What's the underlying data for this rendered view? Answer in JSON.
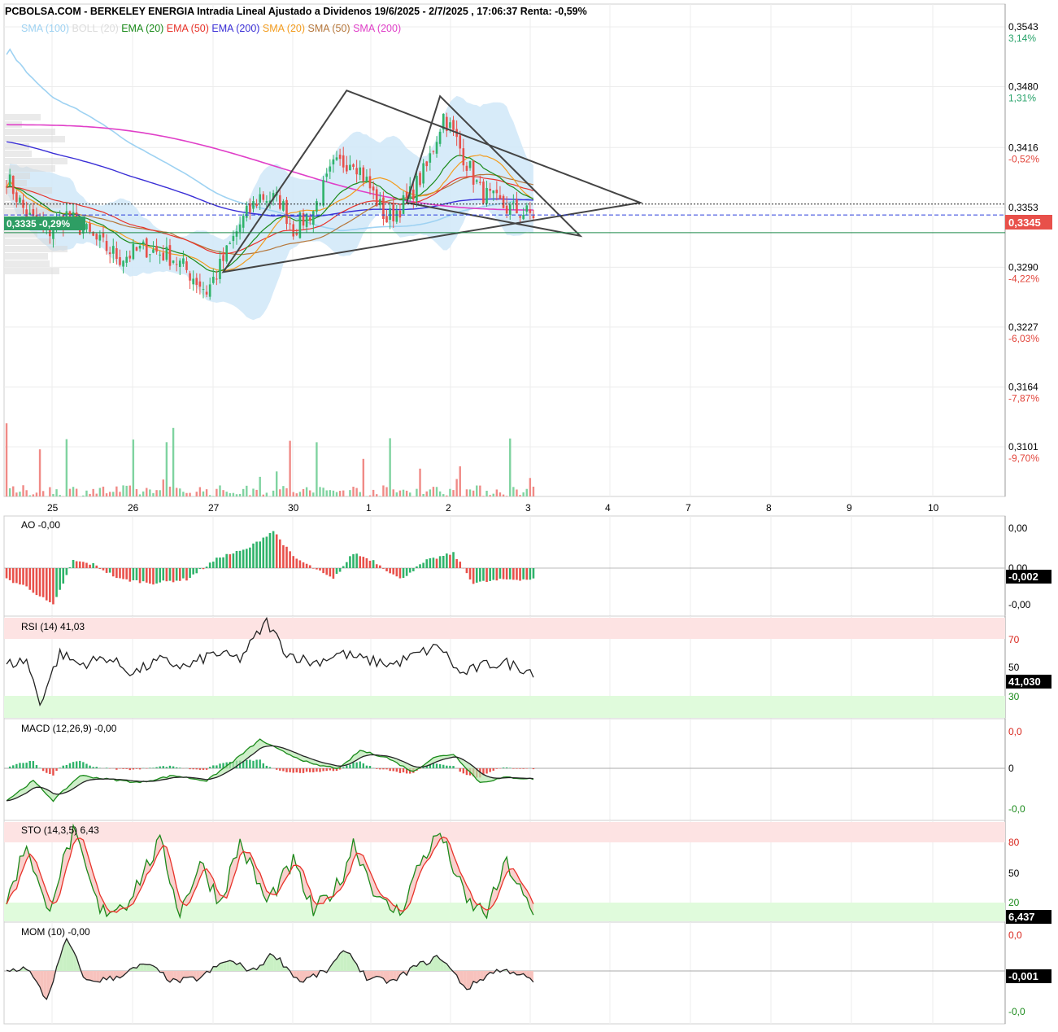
{
  "title": "PCBOLSA.COM - BERKELEY ENERGIA Intradia Lineal Ajustado a Dividenos 19/6/2025 - 2/7/2025 , 17:06:37 Renta: -0,59%",
  "legend": [
    {
      "label": "SMA (100)",
      "color": "#9ed2f2"
    },
    {
      "label": "BOLL (20)",
      "color": "#dcdcdc"
    },
    {
      "label": "EMA (20)",
      "color": "#1a8a1a"
    },
    {
      "label": "EMA (50)",
      "color": "#e8332a"
    },
    {
      "label": "EMA (200)",
      "color": "#3a2fd6"
    },
    {
      "label": "SMA (20)",
      "color": "#f39c1e"
    },
    {
      "label": "SMA (50)",
      "color": "#b5763a"
    },
    {
      "label": "SMA (200)",
      "color": "#e03fc8"
    }
  ],
  "price_axis": [
    {
      "value": "0,3543",
      "pct": "3,14%",
      "pct_color": "#26a269"
    },
    {
      "value": "0,3480",
      "pct": "1,31%",
      "pct_color": "#26a269"
    },
    {
      "value": "0,3416",
      "pct": "-0,52%",
      "pct_color": "#e2443a"
    },
    {
      "value": "0,3353",
      "pct": "",
      "pct_color": "#e2443a"
    },
    {
      "value": "0,3290",
      "pct": "-4,22%",
      "pct_color": "#e2443a"
    },
    {
      "value": "0,3227",
      "pct": "-6,03%",
      "pct_color": "#e2443a"
    },
    {
      "value": "0,3164",
      "pct": "-7,87%",
      "pct_color": "#e2443a"
    },
    {
      "value": "0,3101",
      "pct": "-9,70%",
      "pct_color": "#e2443a"
    }
  ],
  "last_price_tag": "0,3345",
  "current_price_label": "0,3335 -0,29%",
  "x_axis_labels": [
    "25",
    "26",
    "27",
    "30",
    "1",
    "2",
    "3",
    "4",
    "7",
    "8",
    "9",
    "10"
  ],
  "colors": {
    "up": "#2fb36a",
    "down": "#e8504a",
    "band": "#d3e9f8"
  },
  "chart_data": {
    "type": "candlestick",
    "title": "PCBOLSA.COM - BERKELEY ENERGIA Intradia Lineal Ajustado a Dividenos 19/6/2025 - 2/7/2025 , 17:06:37 Renta: -0,59%",
    "x": [
      "25",
      "26",
      "27",
      "30",
      "1",
      "2",
      "3",
      "4",
      "7",
      "8",
      "9",
      "10"
    ],
    "y_ticks": [
      0.3543,
      0.348,
      0.3416,
      0.3353,
      0.329,
      0.3227,
      0.3164,
      0.3101
    ],
    "ylim": [
      0.308,
      0.356
    ],
    "last_close": 0.3345,
    "reference_price": 0.3335,
    "reference_change": "-0,29%",
    "close_anchors": [
      [
        0,
        0.3385
      ],
      [
        6,
        0.3345
      ],
      [
        12,
        0.3325
      ],
      [
        18,
        0.3345
      ],
      [
        26,
        0.332
      ],
      [
        34,
        0.33
      ],
      [
        42,
        0.331
      ],
      [
        50,
        0.33
      ],
      [
        56,
        0.328
      ],
      [
        60,
        0.3265
      ],
      [
        64,
        0.329
      ],
      [
        70,
        0.3335
      ],
      [
        76,
        0.3365
      ],
      [
        82,
        0.336
      ],
      [
        86,
        0.333
      ],
      [
        92,
        0.335
      ],
      [
        98,
        0.3395
      ],
      [
        104,
        0.3405
      ],
      [
        108,
        0.338
      ],
      [
        114,
        0.334
      ],
      [
        120,
        0.336
      ],
      [
        126,
        0.3395
      ],
      [
        131,
        0.345
      ],
      [
        134,
        0.343
      ],
      [
        138,
        0.34
      ],
      [
        142,
        0.337
      ],
      [
        146,
        0.336
      ],
      [
        150,
        0.3352
      ],
      [
        154,
        0.3348
      ],
      [
        158,
        0.3345
      ]
    ],
    "triangles": [
      {
        "points": [
          [
            65,
            0.3285
          ],
          [
            102,
            0.3476
          ],
          [
            190,
            0.3358
          ]
        ]
      },
      {
        "points": [
          [
            120,
            0.3358
          ],
          [
            172,
            0.3323
          ],
          [
            130,
            0.347
          ]
        ]
      }
    ],
    "volume_ylim": [
      0,
      100
    ],
    "indicators": [
      {
        "name": "AO",
        "label": "AO",
        "value": "-0,00",
        "axis": [
          "0,00",
          "0,00",
          "-0,00"
        ],
        "last": "-0,002",
        "anchors": [
          [
            0,
            -0.3
          ],
          [
            6,
            -0.5
          ],
          [
            14,
            -1.0
          ],
          [
            20,
            0.2
          ],
          [
            26,
            0.1
          ],
          [
            34,
            -0.3
          ],
          [
            44,
            -0.4
          ],
          [
            54,
            -0.3
          ],
          [
            64,
            0.3
          ],
          [
            72,
            0.5
          ],
          [
            80,
            1.0
          ],
          [
            86,
            0.3
          ],
          [
            92,
            0.0
          ],
          [
            98,
            -0.3
          ],
          [
            104,
            0.4
          ],
          [
            110,
            0.2
          ],
          [
            118,
            -0.3
          ],
          [
            126,
            0.2
          ],
          [
            134,
            0.4
          ],
          [
            140,
            -0.4
          ],
          [
            150,
            -0.3
          ],
          [
            158,
            -0.3
          ]
        ]
      },
      {
        "name": "RSI",
        "label": "RSI (14)",
        "value": "41,03",
        "levels": [
          "70",
          "50",
          "30"
        ],
        "last": "41,030",
        "anchors": [
          [
            0,
            52
          ],
          [
            6,
            55
          ],
          [
            10,
            25
          ],
          [
            16,
            60
          ],
          [
            22,
            52
          ],
          [
            30,
            57
          ],
          [
            38,
            46
          ],
          [
            46,
            55
          ],
          [
            54,
            50
          ],
          [
            62,
            60
          ],
          [
            70,
            56
          ],
          [
            78,
            82
          ],
          [
            84,
            60
          ],
          [
            92,
            53
          ],
          [
            100,
            60
          ],
          [
            108,
            55
          ],
          [
            116,
            52
          ],
          [
            124,
            60
          ],
          [
            130,
            65
          ],
          [
            136,
            45
          ],
          [
            144,
            52
          ],
          [
            150,
            53
          ],
          [
            158,
            47
          ]
        ]
      },
      {
        "name": "MACD",
        "label": "MACD (12,26,9)",
        "value": "-0,00",
        "axis": [
          "0,0",
          "0",
          "-0,0"
        ],
        "anchors": [
          [
            0,
            -0.9
          ],
          [
            8,
            -0.35
          ],
          [
            14,
            -0.9
          ],
          [
            22,
            -0.2
          ],
          [
            30,
            -0.3
          ],
          [
            40,
            -0.4
          ],
          [
            50,
            -0.2
          ],
          [
            60,
            -0.35
          ],
          [
            68,
            0.2
          ],
          [
            76,
            0.8
          ],
          [
            82,
            0.5
          ],
          [
            92,
            0.1
          ],
          [
            100,
            0.0
          ],
          [
            106,
            0.5
          ],
          [
            114,
            0.3
          ],
          [
            122,
            -0.1
          ],
          [
            128,
            0.3
          ],
          [
            134,
            0.4
          ],
          [
            142,
            -0.4
          ],
          [
            150,
            -0.25
          ],
          [
            158,
            -0.3
          ]
        ]
      },
      {
        "name": "STO",
        "label": "STO (14,3,5)",
        "value": "6,43",
        "levels": [
          "80",
          "50",
          "20"
        ],
        "last": "6,437",
        "anchors": [
          [
            0,
            20
          ],
          [
            6,
            80
          ],
          [
            12,
            10
          ],
          [
            20,
            90
          ],
          [
            28,
            10
          ],
          [
            36,
            20
          ],
          [
            46,
            80
          ],
          [
            52,
            10
          ],
          [
            58,
            60
          ],
          [
            64,
            20
          ],
          [
            70,
            80
          ],
          [
            78,
            20
          ],
          [
            86,
            60
          ],
          [
            92,
            10
          ],
          [
            100,
            40
          ],
          [
            104,
            80
          ],
          [
            112,
            20
          ],
          [
            118,
            10
          ],
          [
            124,
            60
          ],
          [
            130,
            90
          ],
          [
            138,
            20
          ],
          [
            144,
            10
          ],
          [
            150,
            60
          ],
          [
            158,
            5
          ]
        ]
      },
      {
        "name": "MOM",
        "label": "MOM (10)",
        "value": "-0,00",
        "axis": [
          "0,0",
          "",
          "-0,0"
        ],
        "last": "-0,001",
        "anchors": [
          [
            0,
            0.0
          ],
          [
            6,
            0.1
          ],
          [
            12,
            -0.8
          ],
          [
            18,
            0.9
          ],
          [
            24,
            -0.3
          ],
          [
            32,
            -0.2
          ],
          [
            42,
            0.2
          ],
          [
            50,
            -0.3
          ],
          [
            58,
            -0.2
          ],
          [
            66,
            0.3
          ],
          [
            74,
            0.0
          ],
          [
            80,
            0.5
          ],
          [
            88,
            -0.3
          ],
          [
            96,
            0.0
          ],
          [
            102,
            0.6
          ],
          [
            108,
            -0.2
          ],
          [
            116,
            -0.3
          ],
          [
            122,
            0.1
          ],
          [
            130,
            0.4
          ],
          [
            138,
            -0.5
          ],
          [
            146,
            0.0
          ],
          [
            152,
            0.0
          ],
          [
            158,
            -0.3
          ]
        ]
      }
    ]
  }
}
